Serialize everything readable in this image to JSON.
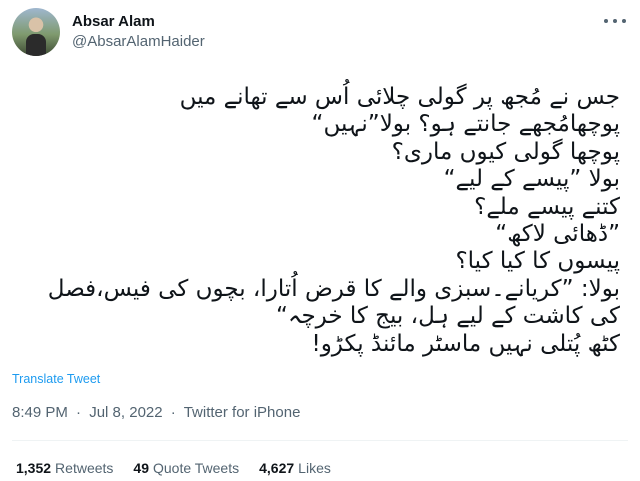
{
  "author": {
    "display_name": "Absar Alam",
    "handle": "@AbsarAlamHaider"
  },
  "tweet": {
    "lines": [
      "جس نے مُجھ پر گولی چلائی اُس سے تھانے میں",
      "پوچھامُجھے جانتے ہو؟ بولا”نہیں“",
      "پوچھا گولی کیوں ماری؟",
      "بولا ”پیسے کے لیے“",
      "کتنے پیسے ملے؟",
      "”ڈھائی لاکھ“",
      "پیسوں کا کیا کیا؟",
      "بولا: ”کریانے۔سبزی والے کا قرض اُتارا، بچوں کی فیس،فصل",
      "کی کاشت کے لیے ہل، بیج کا خرچہ“",
      "کٹھ پُتلی نہیں ماسٹر مائنڈ پکڑو!"
    ],
    "translate_label": "Translate Tweet",
    "time": "8:49 PM",
    "date": "Jul 8, 2022",
    "source": "Twitter for iPhone",
    "separator": "·"
  },
  "stats": {
    "retweets_count": "1,352",
    "retweets_label": "Retweets",
    "quote_count": "49",
    "quote_label": "Quote Tweets",
    "likes_count": "4,627",
    "likes_label": "Likes"
  },
  "icons": {
    "more": "more-horizontal-icon"
  },
  "colors": {
    "link": "#1d9bf0",
    "secondary_text": "#536471",
    "primary_text": "#0f1419"
  }
}
